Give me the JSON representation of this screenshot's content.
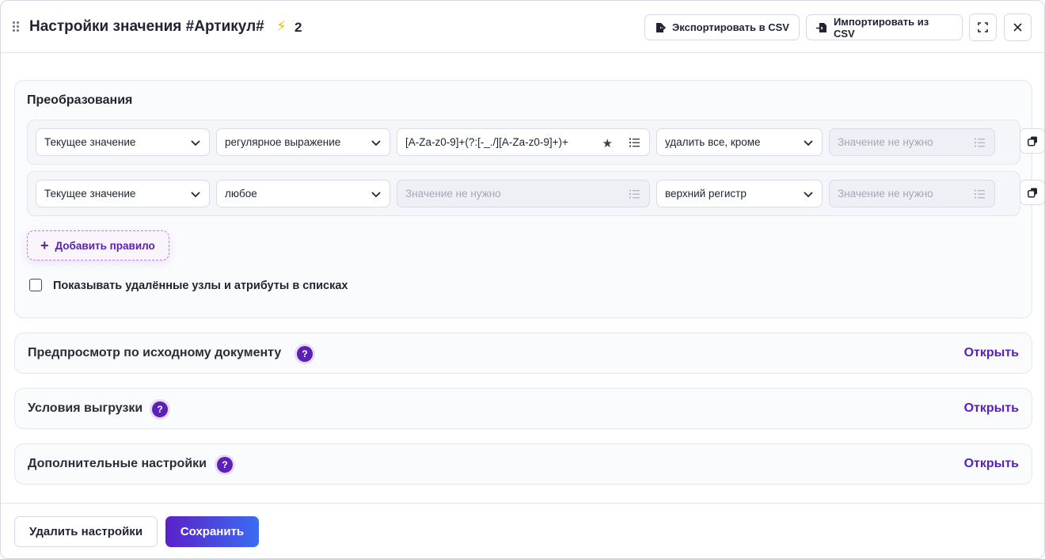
{
  "header": {
    "title": "Настройки значения #Артикул#",
    "bolt_icon": "⚡",
    "count": "2",
    "export_label": "Экспортировать в CSV",
    "import_label": "Импортировать из CSV"
  },
  "transformations": {
    "title": "Преобразования",
    "rules": [
      {
        "source": "Текущее значение",
        "condition": "регулярное выражение",
        "pattern": "[A-Za-z0-9]+(?:[-_./][A-Za-z0-9]+)+",
        "action": "удалить все, кроме",
        "value_placeholder": "Значение не нужно"
      },
      {
        "source": "Текущее значение",
        "condition": "любое",
        "pattern_placeholder": "Значение не нужно",
        "action": "верхний регистр",
        "value_placeholder": "Значение не нужно"
      }
    ],
    "add_rule_label": "Добавить правило",
    "show_deleted_label": "Показывать удалённые узлы и атрибуты в списках",
    "show_deleted_checked": false
  },
  "sections": [
    {
      "title": "Предпросмотр по исходному документу",
      "action": "Открыть"
    },
    {
      "title": "Условия выгрузки",
      "action": "Открыть"
    },
    {
      "title": "Дополнительные настройки",
      "action": "Открыть"
    }
  ],
  "footer": {
    "delete_label": "Удалить настройки",
    "save_label": "Сохранить"
  },
  "colors": {
    "accent": "#5b21b6",
    "save_gradient_start": "#5b21c8",
    "save_gradient_end": "#3b6cf2"
  }
}
